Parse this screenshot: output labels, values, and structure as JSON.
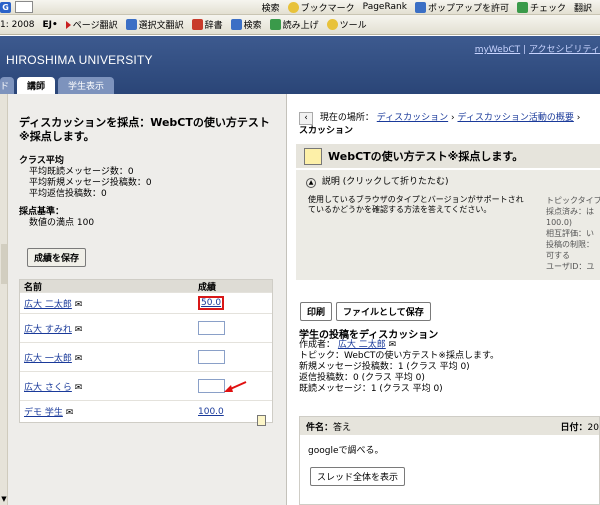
{
  "toolbar1": {
    "g_label": "G",
    "items": [
      "検索",
      "ブックマーク",
      "PageRank",
      "ポップアップを許可",
      "チェック",
      "翻訳"
    ]
  },
  "toolbar2": {
    "items": [
      "1: 2008",
      "EJ•",
      "ページ翻訳",
      "選択文翻訳",
      "辞書",
      "検索",
      "読み上げ",
      "ツール"
    ]
  },
  "header": {
    "university": "HIROSHIMA UNIVERSITY",
    "link_mywebct": "myWebCT",
    "link_sep": "|",
    "link_access": "アクセシビリティ",
    "tab_stub": "ド",
    "tab_instructor": "講師",
    "tab_student": "学生表示"
  },
  "left": {
    "title": "ディスカッションを採点：WebCTの使い方テスト※採点します。",
    "class_avg_heading": "クラス平均",
    "class_avg_lines": [
      "平均既読メッセージ数：0",
      "平均新規メッセージ投稿数：0",
      "平均返信投稿数：0"
    ],
    "criteria_heading": "採点基準：",
    "criteria_value": "数値の満点 100",
    "save_button": "成績を保存",
    "grid_head_name": "名前",
    "grid_head_grade": "成績",
    "rows": [
      {
        "name": "広大 二太郎",
        "grade": "50.0",
        "mode": "value"
      },
      {
        "name": "広大 すみれ",
        "grade": "",
        "mode": "input"
      },
      {
        "name": "広大 一太郎",
        "grade": "",
        "mode": "input"
      },
      {
        "name": "広大 さくら",
        "grade": "",
        "mode": "input"
      },
      {
        "name": "デモ 学生",
        "grade": "100.0",
        "mode": "link"
      }
    ]
  },
  "right": {
    "crumb_prefix": "現在の場所：",
    "crumb_link1": "ディスカッション",
    "crumb_link2": "ディスカッション活動の概要",
    "crumb_tail": "スカッション",
    "title": "WebCTの使い方テスト※採点します。",
    "desc_heading": "説明 (クリックして折りたたむ)",
    "desc_text": "使用しているブラウザのタイプとバージョンがサポートされているかどうかを確認する方法を答えてください。",
    "meta_lines": [
      "トピックタイプ：",
      "採点済み：は",
      "100.0)",
      "相互評価：い",
      "投稿の制限：",
      "可する",
      "ユーザID：ユ"
    ],
    "btn_print": "印刷",
    "btn_save_file": "ファイルとして保存",
    "section_title": "学生の投稿をディスカッション",
    "author_label": "作成者：",
    "author_name": "広大 二太郎",
    "topic_line": "トピック：WebCTの使い方テスト※採点します。",
    "new_posts": "新規メッセージ投稿数：1 (クラス 平均 0)",
    "replies": "返信投稿数：0 (クラス 平均 0)",
    "read_msgs": "既読メッセージ：1 (クラス 平均 0)",
    "post_subject_label": "件名：",
    "post_subject": "答え",
    "post_date_label": "日付：",
    "post_date": "20",
    "post_body": "googleで調べる。",
    "thread_button": "スレッド全体を表示"
  }
}
